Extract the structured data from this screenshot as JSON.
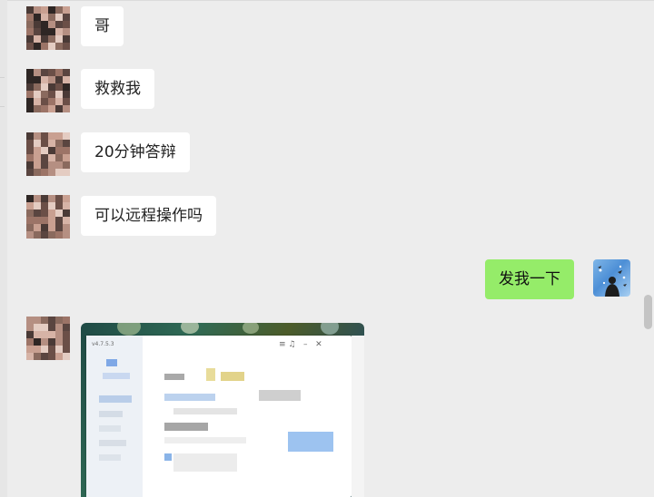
{
  "messages": [
    {
      "from": "other",
      "text": "哥"
    },
    {
      "from": "other",
      "text": "救救我"
    },
    {
      "from": "other",
      "text": "20分钟答辩"
    },
    {
      "from": "other",
      "text": "可以远程操作吗"
    },
    {
      "from": "me",
      "text": "发我一下"
    },
    {
      "from": "other",
      "type": "image",
      "window_version": "v4.7.5.3"
    }
  ],
  "colors": {
    "background": "#ededed",
    "incoming_bubble": "#ffffff",
    "outgoing_bubble": "#95ec69",
    "scrollbar": "#c4c4c4"
  }
}
